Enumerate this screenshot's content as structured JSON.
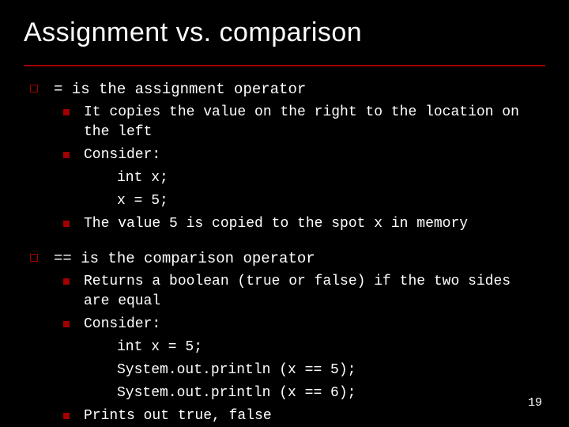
{
  "title": "Assignment vs. comparison",
  "page_number": "19",
  "block1": {
    "header": "= is the assignment operator",
    "pt1": "It copies the value on the right to the location on the left",
    "pt2": "Consider:",
    "code1": "int x;",
    "code2": "x = 5;",
    "pt3": "The value 5 is copied to the spot x in memory"
  },
  "block2": {
    "header": "== is the comparison operator",
    "pt1": "Returns a boolean (true or false) if the two sides are equal",
    "pt2": "Consider:",
    "code1": "int x = 5;",
    "code2": "System.out.println (x == 5);",
    "code3": "System.out.println (x == 6);",
    "pt3": "Prints out true, false"
  }
}
